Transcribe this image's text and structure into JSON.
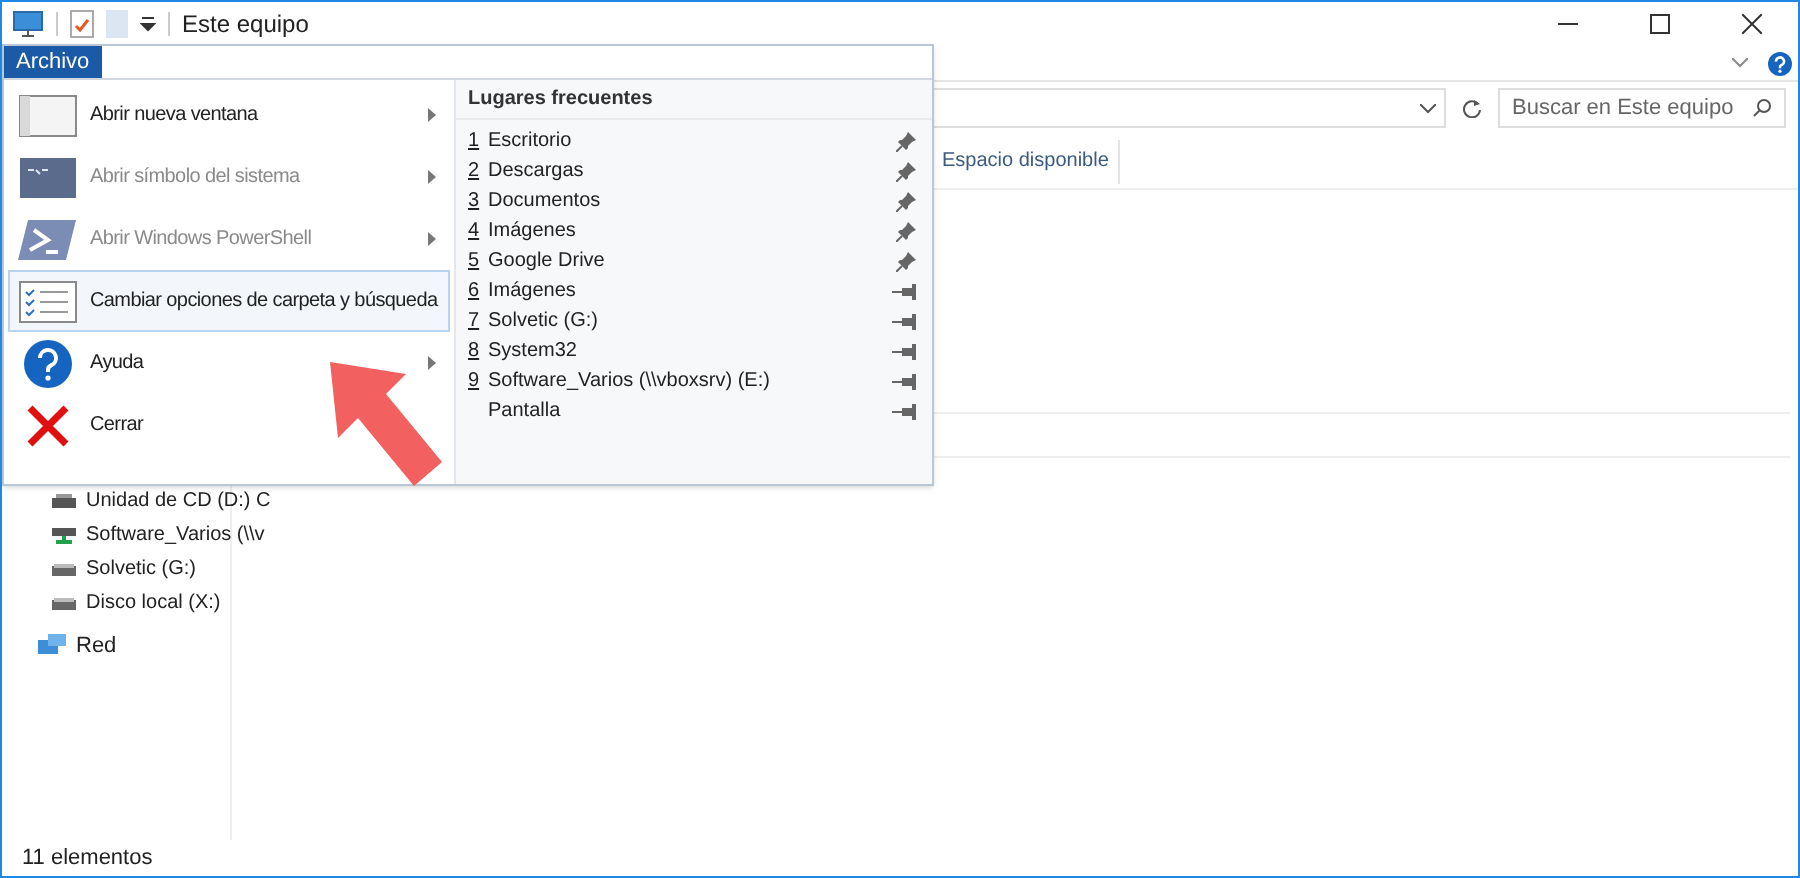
{
  "window": {
    "title": "Este equipo"
  },
  "ribbon": {
    "file_tab": "Archivo"
  },
  "search": {
    "placeholder": "Buscar en Este equipo"
  },
  "columns": [
    "Espacio disponible"
  ],
  "nav": {
    "items": [
      {
        "label": "Unidad de CD (D:) C",
        "kind": "cd"
      },
      {
        "label": "Software_Varios (\\\\v",
        "kind": "network-drive"
      },
      {
        "label": "Solvetic (G:)",
        "kind": "drive"
      },
      {
        "label": "Disco local (X:)",
        "kind": "drive"
      }
    ],
    "network": "Red"
  },
  "file_menu": {
    "commands": [
      {
        "label": "Abrir nueva ventana",
        "kind": "window",
        "disabled": false,
        "selected": false,
        "submenu": true
      },
      {
        "label": "Abrir símbolo del sistema",
        "kind": "cmd",
        "disabled": true,
        "selected": false,
        "submenu": true
      },
      {
        "label": "Abrir Windows PowerShell",
        "kind": "powershell",
        "disabled": true,
        "selected": false,
        "submenu": true
      },
      {
        "label": "Cambiar opciones de carpeta y búsqueda",
        "kind": "options",
        "disabled": false,
        "selected": true,
        "submenu": false
      },
      {
        "label": "Ayuda",
        "kind": "help",
        "disabled": false,
        "selected": false,
        "submenu": true
      },
      {
        "label": "Cerrar",
        "kind": "close",
        "disabled": false,
        "selected": false,
        "submenu": false
      }
    ],
    "frequent_title": "Lugares frecuentes",
    "frequent": [
      {
        "number": "1",
        "label": "Escritorio",
        "pinned": true
      },
      {
        "number": "2",
        "label": "Descargas",
        "pinned": true
      },
      {
        "number": "3",
        "label": "Documentos",
        "pinned": true
      },
      {
        "number": "4",
        "label": "Imágenes",
        "pinned": true
      },
      {
        "number": "5",
        "label": "Google Drive",
        "pinned": true
      },
      {
        "number": "6",
        "label": "Imágenes",
        "pinned": false
      },
      {
        "number": "7",
        "label": "Solvetic (G:)",
        "pinned": false
      },
      {
        "number": "8",
        "label": "System32",
        "pinned": false
      },
      {
        "number": "9",
        "label": "Software_Varios (\\\\vboxsrv) (E:)",
        "pinned": false
      },
      {
        "label": "Pantalla",
        "pinned": false
      }
    ]
  },
  "status_bar": "11 elementos"
}
